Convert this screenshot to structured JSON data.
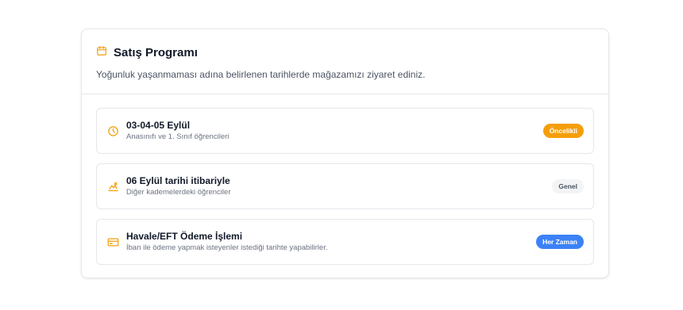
{
  "header": {
    "title": "Satış Programı",
    "subtitle": "Yoğunluk yaşanmaması adına belirlenen tarihlerde mağazamızı ziyaret ediniz.",
    "icon": "calendar-icon"
  },
  "schedule": [
    {
      "title": "03-04-05 Eylül",
      "description": "Anasınıfı ve 1. Sınıf öğrencileri",
      "badge": "Öncelikli",
      "icon": "clock-icon",
      "badge_color": "#f59e0b"
    },
    {
      "title": "06 Eylül tarihi itibariyle",
      "description": "Diğer kademelerdeki öğrenciler",
      "badge": "Genel",
      "icon": "transport-icon",
      "badge_color": "#f3f4f6"
    },
    {
      "title": "Havale/EFT Ödeme İşlemi",
      "description": "İban ile ödeme yapmak isteyenler istediği tarihte yapabilirler.",
      "badge": "Her Zaman",
      "icon": "credit-card-icon",
      "badge_color": "#3b82f6"
    }
  ],
  "colors": {
    "accent": "#f59e0b",
    "border": "#e5e7eb",
    "blue": "#3b82f6"
  }
}
